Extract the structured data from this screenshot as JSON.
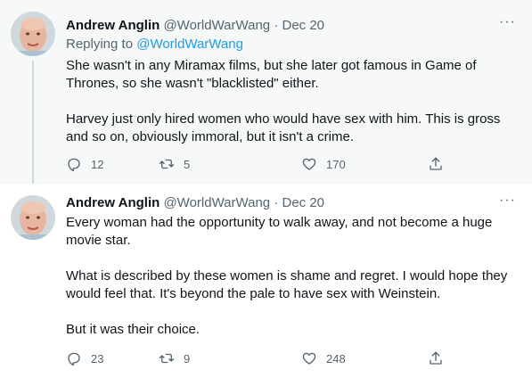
{
  "tweets": [
    {
      "author_name": "Andrew Anglin",
      "handle": "@WorldWarWang",
      "separator": "·",
      "date": "Dec 20",
      "replying_label": "Replying to",
      "replying_handle": "@WorldWarWang",
      "paragraphs": [
        "She wasn't in any Miramax films, but she later got famous in Game of Thrones, so she wasn't \"blacklisted\" either.",
        "Harvey just only hired women who would have sex with him. This is gross and so on, obviously immoral, but it isn't a crime."
      ],
      "replies": "12",
      "retweets": "5",
      "likes": "170",
      "more": "···"
    },
    {
      "author_name": "Andrew Anglin",
      "handle": "@WorldWarWang",
      "separator": "·",
      "date": "Dec 20",
      "paragraphs": [
        "Every woman had the opportunity to walk away, and not become a huge movie star.",
        "What is described by these women is shame and regret. I would hope they would feel that. It's beyond the pale to have sex with Weinstein.",
        "But it was their choice."
      ],
      "replies": "23",
      "retweets": "9",
      "likes": "248",
      "more": "···"
    }
  ],
  "icons": {
    "reply": "reply-icon",
    "retweet": "retweet-icon",
    "like": "heart-icon",
    "share": "share-icon",
    "more": "more-icon"
  },
  "colors": {
    "accent": "#1d9bf0",
    "secondary_text": "#536471",
    "primary_text": "#0f1419",
    "thread_bg": "#f7f9f9"
  }
}
